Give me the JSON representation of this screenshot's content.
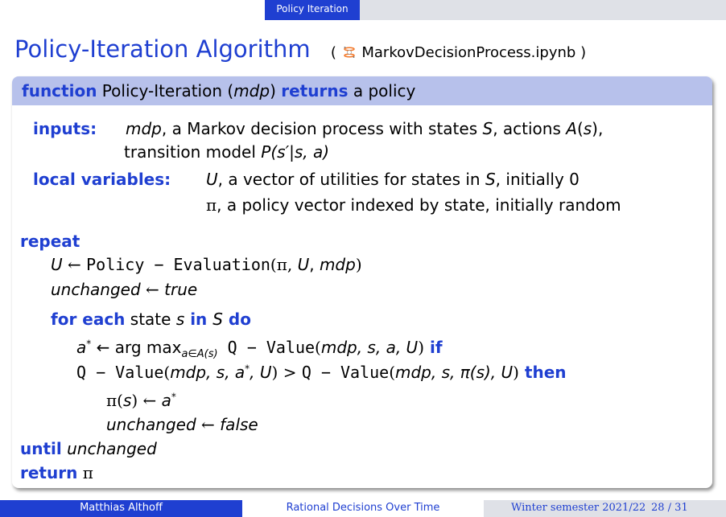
{
  "nav": {
    "section": "Policy Iteration"
  },
  "title": {
    "main": "Policy-Iteration Algorithm",
    "open_paren": "(",
    "notebook": "MarkovDecisionProcess.ipynb",
    "close_paren": ")"
  },
  "block": {
    "head": {
      "kw_function": "function",
      "name": "Policy-Iteration",
      "param_open": " (",
      "param": "mdp",
      "param_close": ")",
      "kw_returns": "returns",
      "tail": "a policy"
    }
  },
  "body": {
    "inputs": {
      "label": "inputs:",
      "p1": "mdp",
      "p2": ", a Markov decision process with states ",
      "S": "S",
      "p3": ", actions ",
      "A": "A",
      "p4": "(",
      "s": "s",
      "p5": "),",
      "line2a": "transition model ",
      "P": "P",
      "line2b": "(s′|s, a)"
    },
    "locals": {
      "label": "local variables:",
      "U": "U",
      "u_text": ", a vector of utilities for states in ",
      "S": "S",
      "u_tail": ", initially 0",
      "pi": "π",
      "pi_text": ", a policy vector indexed by state, initially random"
    },
    "algo": {
      "repeat": "repeat",
      "l1a": "U",
      "l1b": " ← ",
      "l1c": "Policy − Evaluation",
      "l1d": "(π, ",
      "l1e": "U",
      "l1f": ", ",
      "l1g": "mdp",
      "l1h": ")",
      "l2a": "unchanged",
      "l2b": " ← ",
      "l2c": "true",
      "l3a": "for each",
      "l3b": " state ",
      "l3c": "s",
      "l3d": " in ",
      "l3e": "S",
      "l3f": " do",
      "l4a": "a",
      "l4b": "*",
      "l4c": " ← arg max",
      "l4d": "a∈A(s)",
      "l4e": " Q − Value",
      "l4f": "(",
      "l4g": "mdp, s, a, U",
      "l4h": ")",
      "l4i": " if",
      "l5a": "Q − Value",
      "l5b": "(",
      "l5c": "mdp, s, a",
      "l5d": "*",
      "l5e": ", U",
      "l5f": ") > ",
      "l5g": "Q − Value",
      "l5h": "(",
      "l5i": "mdp, s, ",
      "l5j": "π(s), U",
      "l5k": ")",
      "l5l": " then",
      "l6a": "π(",
      "l6b": "s",
      "l6c": ") ← ",
      "l6d": "a",
      "l6e": "*",
      "l7a": "unchanged",
      "l7b": " ← ",
      "l7c": "false",
      "until": "until",
      "until_val": "unchanged",
      "ret": "return",
      "ret_val": "π"
    }
  },
  "footer": {
    "author": "Matthias Althoff",
    "course": "Rational Decisions Over Time",
    "semester": "Winter semester 2021/22",
    "page": "28 / 31"
  },
  "colors": {
    "accent": "#1f3fd1",
    "block_head": "#b7c1eb",
    "footer_gray": "#dfe1e7"
  },
  "icons": {
    "notebook": "jupyter-icon"
  }
}
